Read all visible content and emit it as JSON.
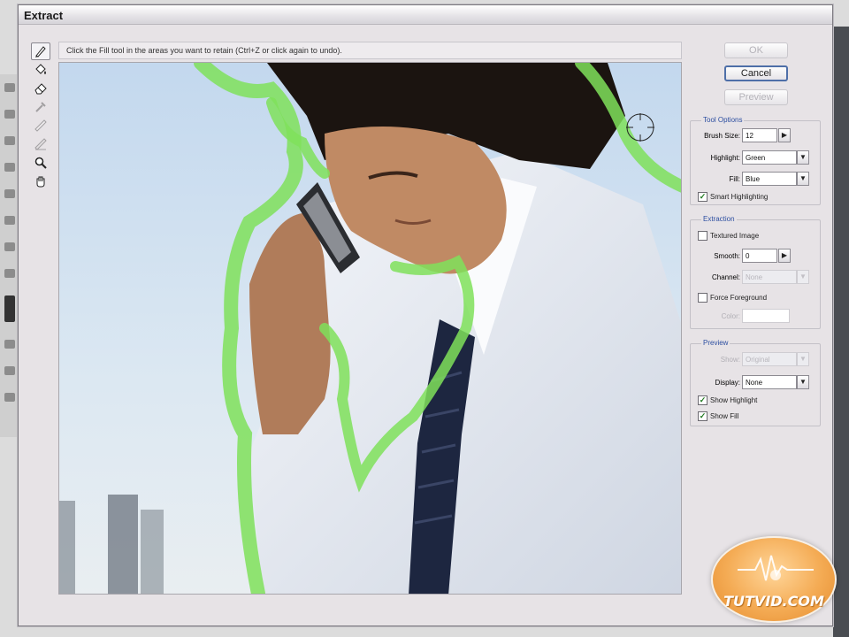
{
  "window": {
    "title": "Extract"
  },
  "instructions": "Click the Fill tool in the areas you want to retain (Ctrl+Z or click again to undo).",
  "buttons": {
    "ok": "OK",
    "cancel": "Cancel",
    "preview": "Preview"
  },
  "tool_options": {
    "title": "Tool Options",
    "brush_size_label": "Brush Size:",
    "brush_size_value": "12",
    "highlight_label": "Highlight:",
    "highlight_value": "Green",
    "fill_label": "Fill:",
    "fill_value": "Blue",
    "smart_highlighting_label": "Smart Highlighting",
    "smart_highlighting_checked": true
  },
  "extraction": {
    "title": "Extraction",
    "textured_image_label": "Textured Image",
    "smooth_label": "Smooth:",
    "smooth_value": "0",
    "channel_label": "Channel:",
    "channel_value": "None",
    "force_foreground_label": "Force Foreground",
    "color_label": "Color:"
  },
  "preview": {
    "title": "Preview",
    "show_label": "Show:",
    "show_value": "Original",
    "display_label": "Display:",
    "display_value": "None",
    "show_highlight_label": "Show Highlight",
    "show_fill_label": "Show Fill"
  },
  "watermark": {
    "text": "TUTVID.COM"
  },
  "icons": [
    "edge-highlighter-icon",
    "fill-tool-icon",
    "eraser-icon",
    "eyedropper-icon",
    "cleanup-tool-icon",
    "edge-touchup-icon",
    "zoom-icon",
    "hand-icon"
  ],
  "colors": {
    "highlight": "#7fe05a",
    "accent": "#2c4ea0",
    "watermark": "#f4ab54"
  }
}
